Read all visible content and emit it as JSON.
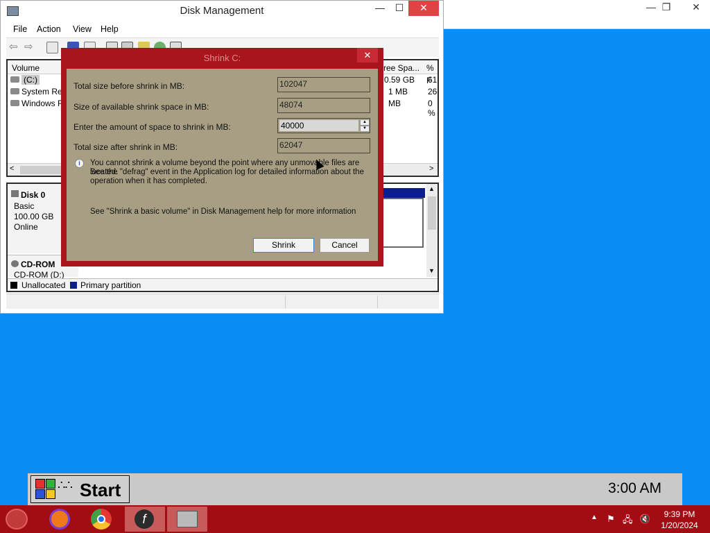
{
  "background_window": {
    "min_btn": "—",
    "max_btn": "❐",
    "close_btn": "✕"
  },
  "disk_management": {
    "title": "Disk Management",
    "caption": {
      "min": "—",
      "max": "☐",
      "close": "✕"
    },
    "menu": [
      "File",
      "Action",
      "View",
      "Help"
    ],
    "volume_list": {
      "columns": {
        "volume": "Volume",
        "free_space": "ree Spa...",
        "pct": "% F"
      },
      "rows": [
        {
          "name": "(C:)",
          "free": "0.59 GB",
          "pct": "61"
        },
        {
          "name": "System Res",
          "free": "1 MB",
          "pct": "26"
        },
        {
          "name": "Windows R",
          "free": "MB",
          "pct": "0 %"
        }
      ]
    },
    "disk0": {
      "name": "Disk 0",
      "type": "Basic",
      "size": "100.00 GB",
      "status": "Online"
    },
    "cdrom": {
      "name": "CD-ROM",
      "label": "CD-ROM (D:)"
    },
    "legend": {
      "unallocated": "Unallocated",
      "primary": "Primary partition",
      "unallocated_color": "#000000",
      "primary_color": "#0a1e8c"
    }
  },
  "shrink_dialog": {
    "title": "Shrink C:",
    "close": "✕",
    "total_before_label": "Total size before shrink in MB:",
    "total_before_value": "102047",
    "available_label": "Size of available shrink space in MB:",
    "available_value": "48074",
    "amount_label": "Enter the amount of space to shrink in MB:",
    "amount_value": "40000",
    "total_after_label": "Total size after shrink in MB:",
    "total_after_value": "62047",
    "info_line1": "You cannot shrink a volume beyond the point where any unmovable files are located.",
    "info_line2": "See the \"defrag\" event in the Application log for detailed information about the",
    "info_line3": "operation when it has completed.",
    "help_text": "See \"Shrink a basic volume\" in Disk Management help for more information",
    "shrink_btn": "Shrink",
    "cancel_btn": "Cancel"
  },
  "start_bar": {
    "start_label": "Start",
    "clock": "3:00 AM"
  },
  "taskbar": {
    "tray_time": "9:39 PM",
    "tray_date": "1/20/2024"
  }
}
